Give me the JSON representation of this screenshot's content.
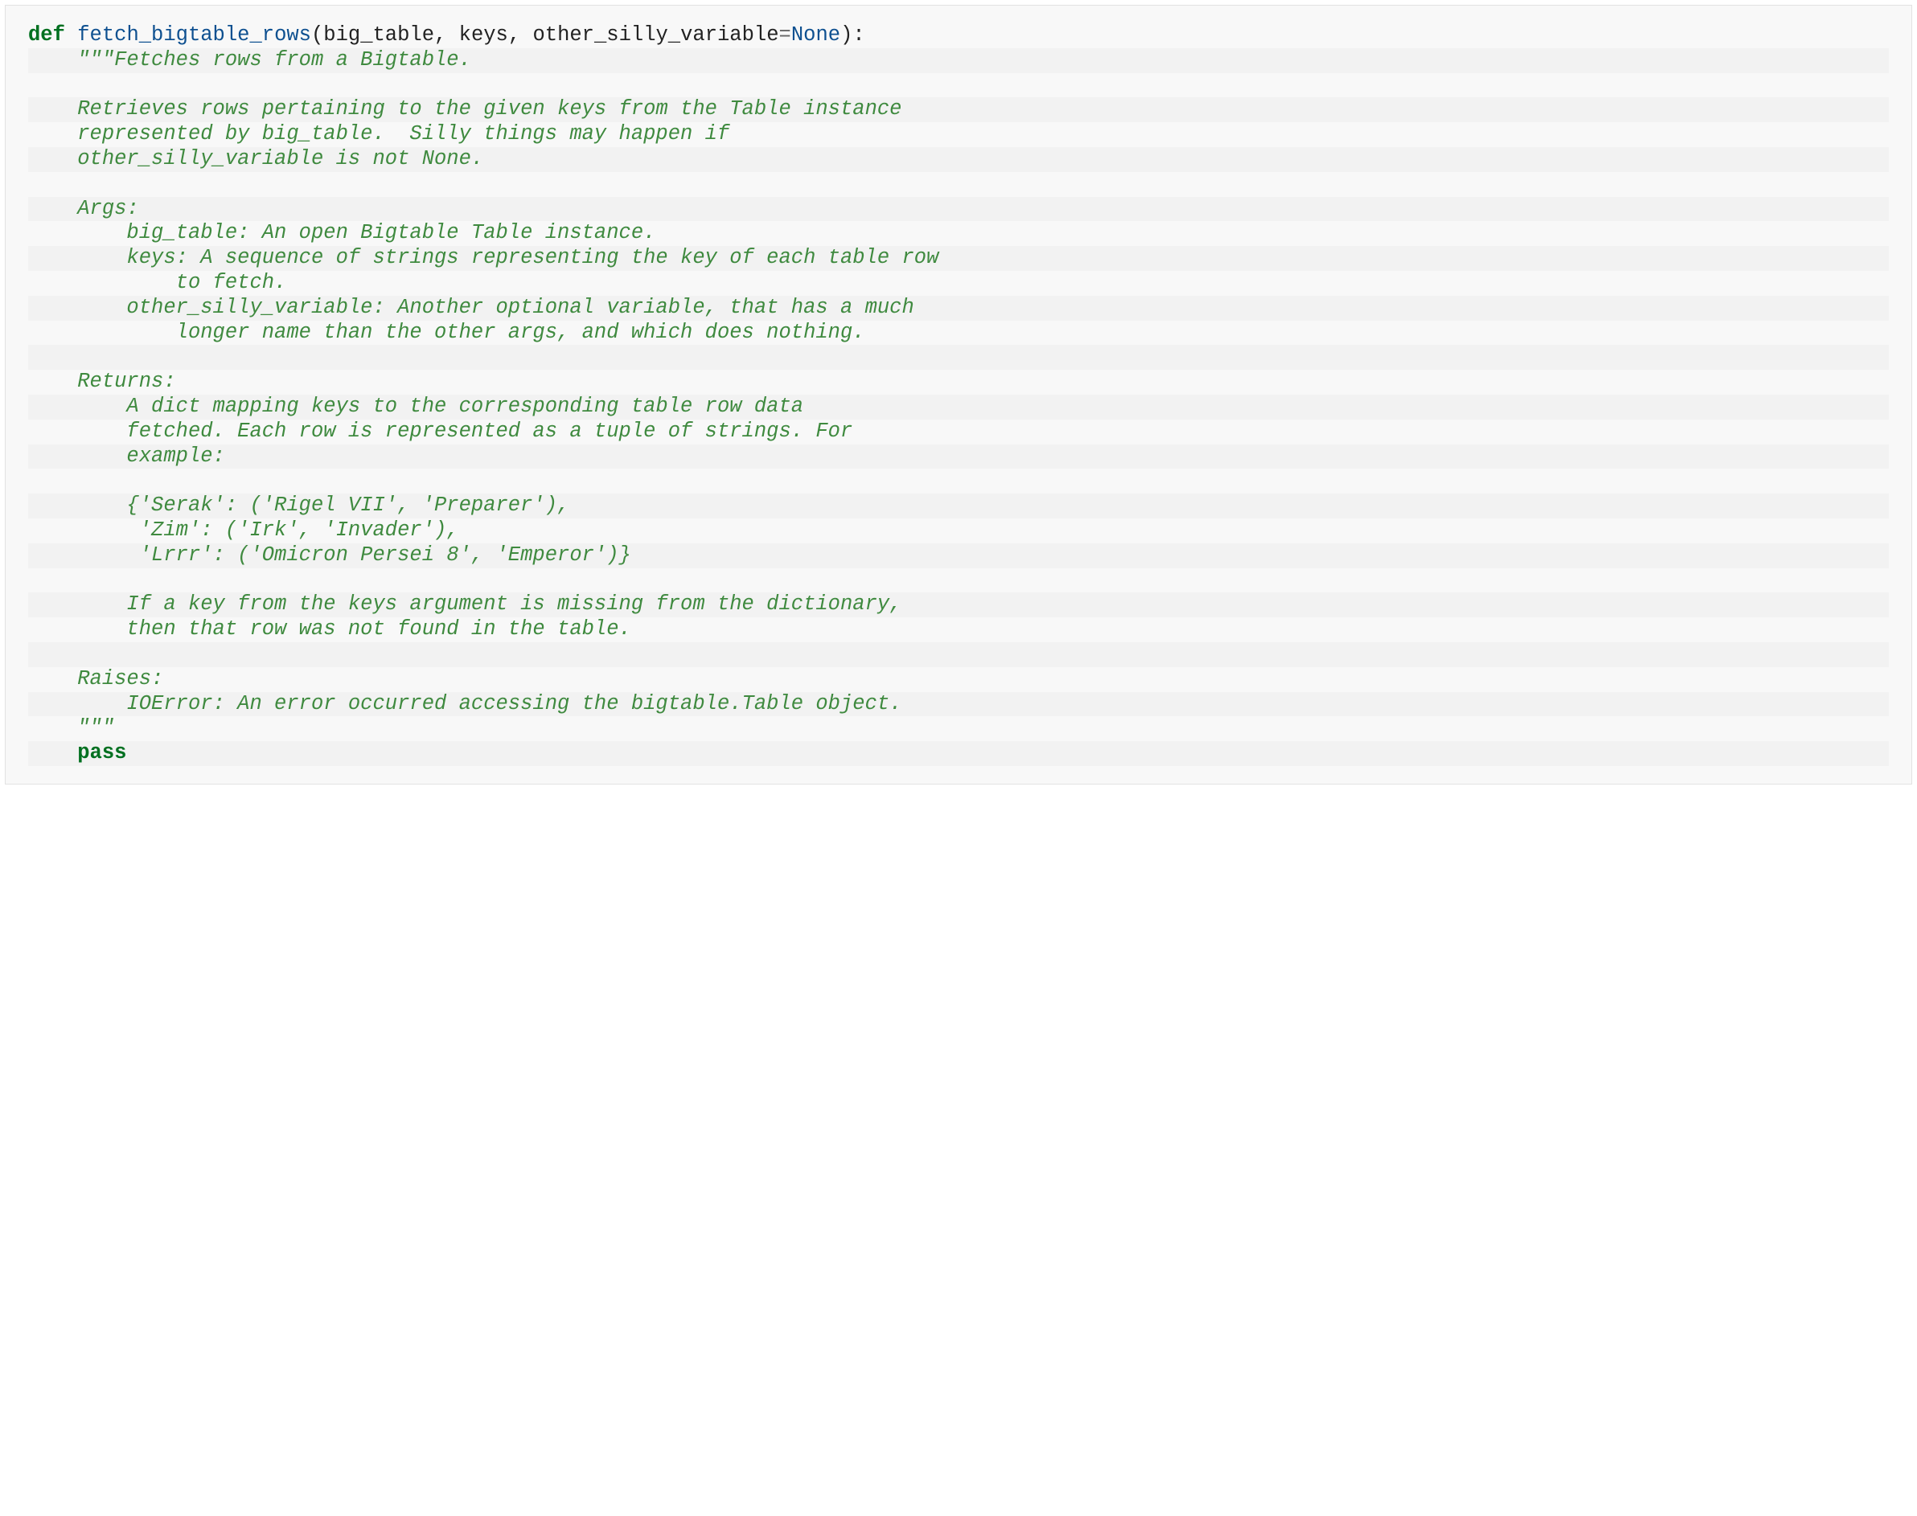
{
  "code": {
    "keyword_def": "def",
    "func_name": "fetch_bigtable_rows",
    "lparen": "(",
    "param1": "big_table",
    "comma": ", ",
    "param2": "keys",
    "param3": "other_silly_variable",
    "eq": "=",
    "none": "None",
    "rparen": ")",
    "colon": ":",
    "doc_open": "\"\"\"Fetches rows from a Bigtable.",
    "doc_body": [
      "",
      "Retrieves rows pertaining to the given keys from the Table instance",
      "represented by big_table.  Silly things may happen if",
      "other_silly_variable is not None.",
      "",
      "Args:",
      "    big_table: An open Bigtable Table instance.",
      "    keys: A sequence of strings representing the key of each table row",
      "        to fetch.",
      "    other_silly_variable: Another optional variable, that has a much",
      "        longer name than the other args, and which does nothing.",
      "",
      "Returns:",
      "    A dict mapping keys to the corresponding table row data",
      "    fetched. Each row is represented as a tuple of strings. For",
      "    example:",
      "",
      "    {'Serak': ('Rigel VII', 'Preparer'),",
      "     'Zim': ('Irk', 'Invader'),",
      "     'Lrrr': ('Omicron Persei 8', 'Emperor')}",
      "",
      "    If a key from the keys argument is missing from the dictionary,",
      "    then that row was not found in the table.",
      "",
      "Raises:",
      "    IOError: An error occurred accessing the bigtable.Table object."
    ],
    "doc_close": "\"\"\"",
    "keyword_pass": "pass"
  }
}
